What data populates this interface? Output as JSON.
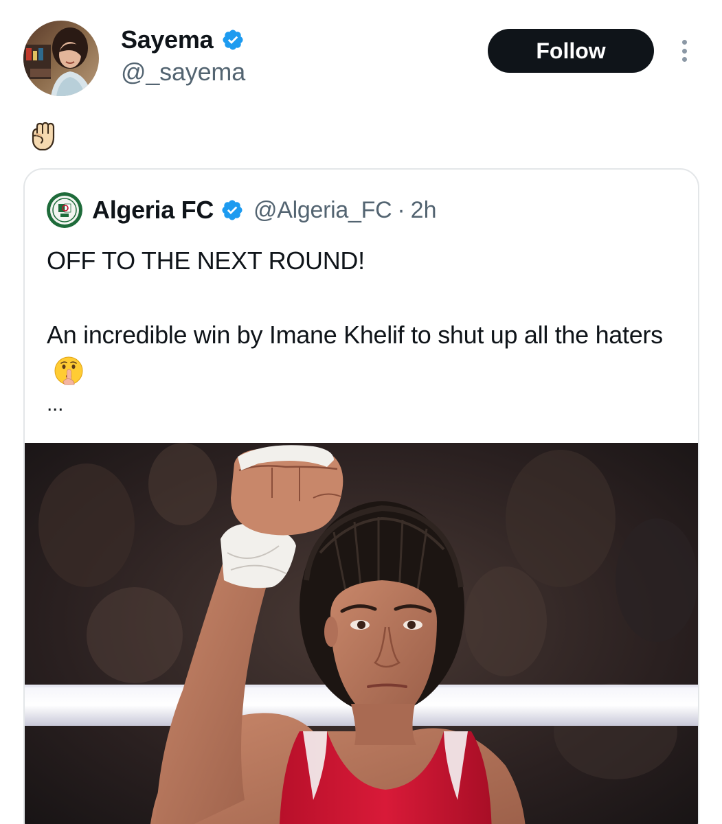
{
  "author": {
    "name": "Sayema",
    "handle": "@_sayema",
    "verified": true
  },
  "actions": {
    "follow_label": "Follow"
  },
  "post": {
    "emoji": "raised-fist-emoji"
  },
  "quoted": {
    "name": "Algeria FC",
    "handle": "@Algeria_FC",
    "separator": "·",
    "time": "2h",
    "verified": true,
    "text_line1": "OFF TO THE NEXT ROUND!",
    "text_line2": "An incredible win by Imane Khelif to shut up all the haters",
    "ellipsis": "...",
    "emoji": "shushing-face-emoji"
  },
  "colors": {
    "verified_blue": "#1d9bf0",
    "follow_bg": "#0f1419",
    "secondary_text": "#536471",
    "card_border": "#e3e6e8",
    "singlet_red": "#c8102e"
  }
}
